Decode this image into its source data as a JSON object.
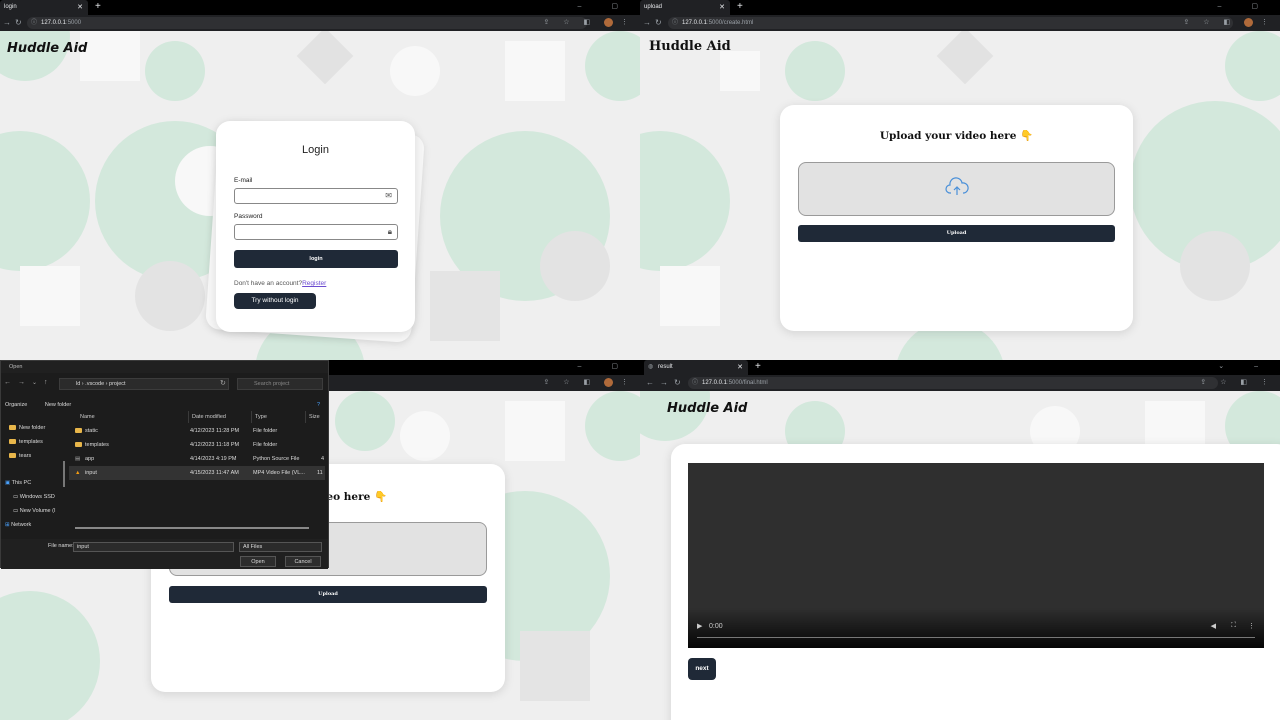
{
  "brand": "Huddle Aid",
  "q1": {
    "tab_title": "login",
    "url_host": "127.0.0.1",
    "url_rest": ":5000",
    "login": {
      "title": "Login",
      "email_label": "E-mail",
      "password_label": "Password",
      "login_button": "login",
      "no_account_text": "Don't have an account?",
      "register_link": "Register",
      "try_without_login": "Try without login"
    }
  },
  "q2": {
    "tab_title": "upload",
    "url_host": "127.0.0.1",
    "url_rest": ":5000/create.html",
    "upload": {
      "title": "Upload your video here 👇",
      "upload_button": "Upload"
    }
  },
  "q3": {
    "dialog": {
      "title": "Open",
      "breadcrumb": [
        "ld",
        ".vscode",
        "project"
      ],
      "search_placeholder": "Search project",
      "organize": "Organize",
      "new_folder": "New folder",
      "sidebar": [
        "New folder",
        "templates",
        "tears",
        "This PC",
        "Windows SSD",
        "New Volume (I",
        "Network"
      ],
      "columns": [
        "Name",
        "Date modified",
        "Type",
        "Size"
      ],
      "rows": [
        {
          "name": "static",
          "date": "4/12/2023 11:28 PM",
          "type": "File folder",
          "size": ""
        },
        {
          "name": "templates",
          "date": "4/12/2023 11:18 PM",
          "type": "File folder",
          "size": ""
        },
        {
          "name": "app",
          "date": "4/14/2023 4:19 PM",
          "type": "Python Source File",
          "size": "4"
        },
        {
          "name": "input",
          "date": "4/15/2023 11:47 AM",
          "type": "MP4 Video File (VL...",
          "size": "11"
        }
      ],
      "file_name_label": "File name:",
      "file_name_value": "input",
      "file_type": "All Files",
      "open_button": "Open",
      "cancel_button": "Cancel"
    },
    "upload": {
      "title_partial": "video here 👇",
      "upload_button": "Upload"
    }
  },
  "q4": {
    "tab_title": "result",
    "url_host": "127.0.0.1",
    "url_rest": ":5000/final.html",
    "video_time": "0:00",
    "next_button": "next"
  }
}
